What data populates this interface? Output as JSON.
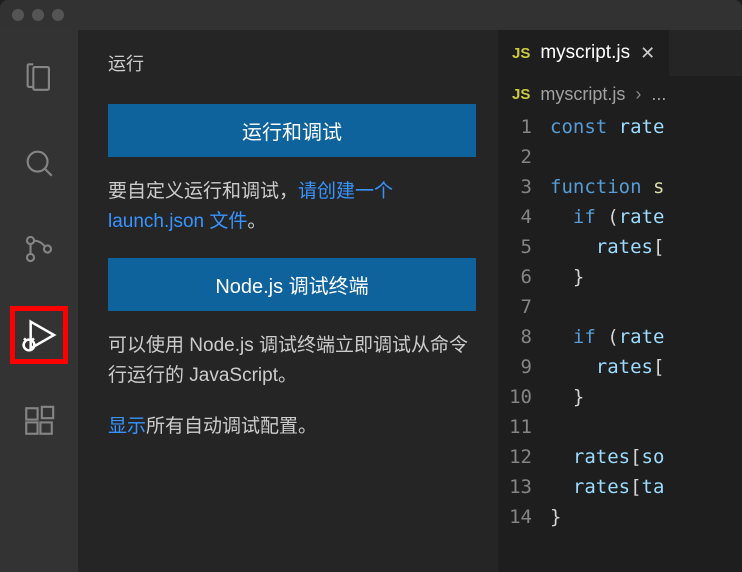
{
  "sidebar": {
    "title": "运行",
    "button1": "运行和调试",
    "text1_pre": "要自定义运行和调试，",
    "text1_link": "请创建一个 launch.json 文件",
    "text1_post": "。",
    "button2": "Node.js 调试终端",
    "text2": "可以使用 Node.js 调试终端立即调试从命令行运行的 JavaScript。",
    "text3_link": "显示",
    "text3_post": "所有自动调试配置。"
  },
  "tab": {
    "icon": "JS",
    "name": "myscript.js"
  },
  "breadcrumb": {
    "icon": "JS",
    "file": "myscript.js",
    "chevron": "›",
    "more": "..."
  },
  "code": {
    "lines": [
      {
        "n": "1",
        "html": "<span class='kw'>const</span> <span class='id'>rate</span>"
      },
      {
        "n": "2",
        "html": ""
      },
      {
        "n": "3",
        "html": "<span class='kw'>function</span> <span class='fn'>s</span>"
      },
      {
        "n": "4",
        "html": "  <span class='kw'>if</span> <span class='pl'>(</span><span class='id'>rate</span>"
      },
      {
        "n": "5",
        "html": "    <span class='id'>rates</span><span class='pl'>[</span>"
      },
      {
        "n": "6",
        "html": "  <span class='pl'>}</span>"
      },
      {
        "n": "7",
        "html": ""
      },
      {
        "n": "8",
        "html": "  <span class='kw'>if</span> <span class='pl'>(</span><span class='id'>rate</span>"
      },
      {
        "n": "9",
        "html": "    <span class='id'>rates</span><span class='pl'>[</span>"
      },
      {
        "n": "10",
        "html": "  <span class='pl'>}</span>"
      },
      {
        "n": "11",
        "html": ""
      },
      {
        "n": "12",
        "html": "  <span class='id'>rates</span><span class='pl'>[</span><span class='id'>so</span>"
      },
      {
        "n": "13",
        "html": "  <span class='id'>rates</span><span class='pl'>[</span><span class='id'>ta</span>"
      },
      {
        "n": "14",
        "html": "<span class='pl'>}</span>"
      }
    ]
  }
}
